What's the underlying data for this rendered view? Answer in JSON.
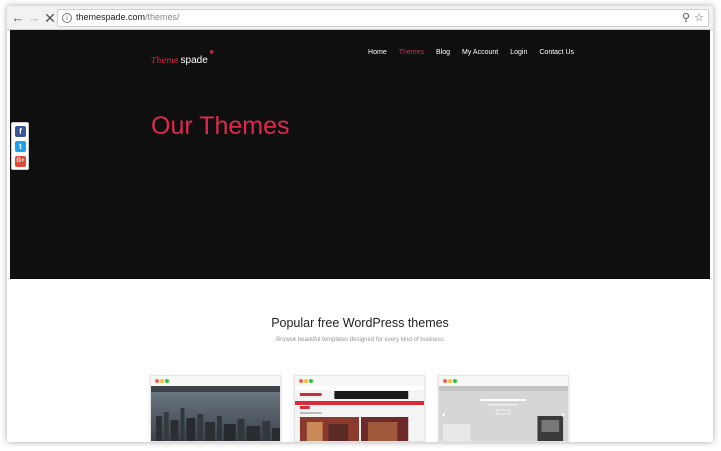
{
  "browser": {
    "url_host": "themespade.com",
    "url_path": "/themes/"
  },
  "site": {
    "logo_script": "Theme",
    "logo_word": "spade",
    "nav": [
      {
        "label": "Home",
        "active": false
      },
      {
        "label": "Themes",
        "active": true
      },
      {
        "label": "Blog",
        "active": false
      },
      {
        "label": "My Account",
        "active": false
      },
      {
        "label": "Login",
        "active": false
      },
      {
        "label": "Contact Us",
        "active": false
      }
    ]
  },
  "hero": {
    "title": "Our Themes"
  },
  "share": {
    "facebook": "f",
    "twitter": "t",
    "googleplus": "G+"
  },
  "section": {
    "title": "Popular free WordPress themes",
    "subtitle": "Browse beautiful templates designed for every kind of business"
  },
  "colors": {
    "accent": "#e0284d",
    "hero_bg": "#0f0f0f"
  }
}
